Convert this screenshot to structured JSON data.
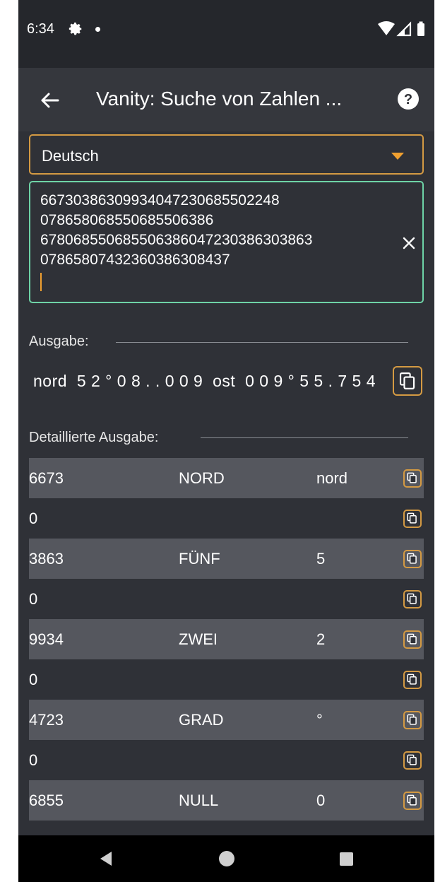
{
  "status_bar": {
    "time": "6:34"
  },
  "app_bar": {
    "title": "Vanity: Suche von Zahlen ..."
  },
  "language_select": {
    "selected": "Deutsch"
  },
  "input": {
    "lines": [
      "6673038630993404723068550224​8",
      "078658068550685506386",
      "67806855068550638604723038630386​3",
      "078658074323603863084​37"
    ]
  },
  "output": {
    "label": "Ausgabe:",
    "value": "nord  5 2 ° 0 8 . . 0 0 9  ost  0 0 9 ° 5 5 . 7 5 4"
  },
  "detail": {
    "label": "Detaillierte Ausgabe:",
    "rows": [
      {
        "number": "6673",
        "word": "NORD",
        "value": "nord",
        "shaded": true
      },
      {
        "number": "0",
        "word": "",
        "value": "",
        "shaded": false
      },
      {
        "number": "3863",
        "word": "FÜNF",
        "value": "5",
        "shaded": true
      },
      {
        "number": "0",
        "word": "",
        "value": "",
        "shaded": false
      },
      {
        "number": "9934",
        "word": "ZWEI",
        "value": "2",
        "shaded": true
      },
      {
        "number": "0",
        "word": "",
        "value": "",
        "shaded": false
      },
      {
        "number": "4723",
        "word": "GRAD",
        "value": "°",
        "shaded": true
      },
      {
        "number": "0",
        "word": "",
        "value": "",
        "shaded": false
      },
      {
        "number": "6855",
        "word": "NULL",
        "value": "0",
        "shaded": true
      }
    ]
  },
  "colors": {
    "accent": "#d49a43",
    "input_border": "#6ed3a6",
    "background": "#2f3137",
    "row_shade": "#55575e"
  }
}
